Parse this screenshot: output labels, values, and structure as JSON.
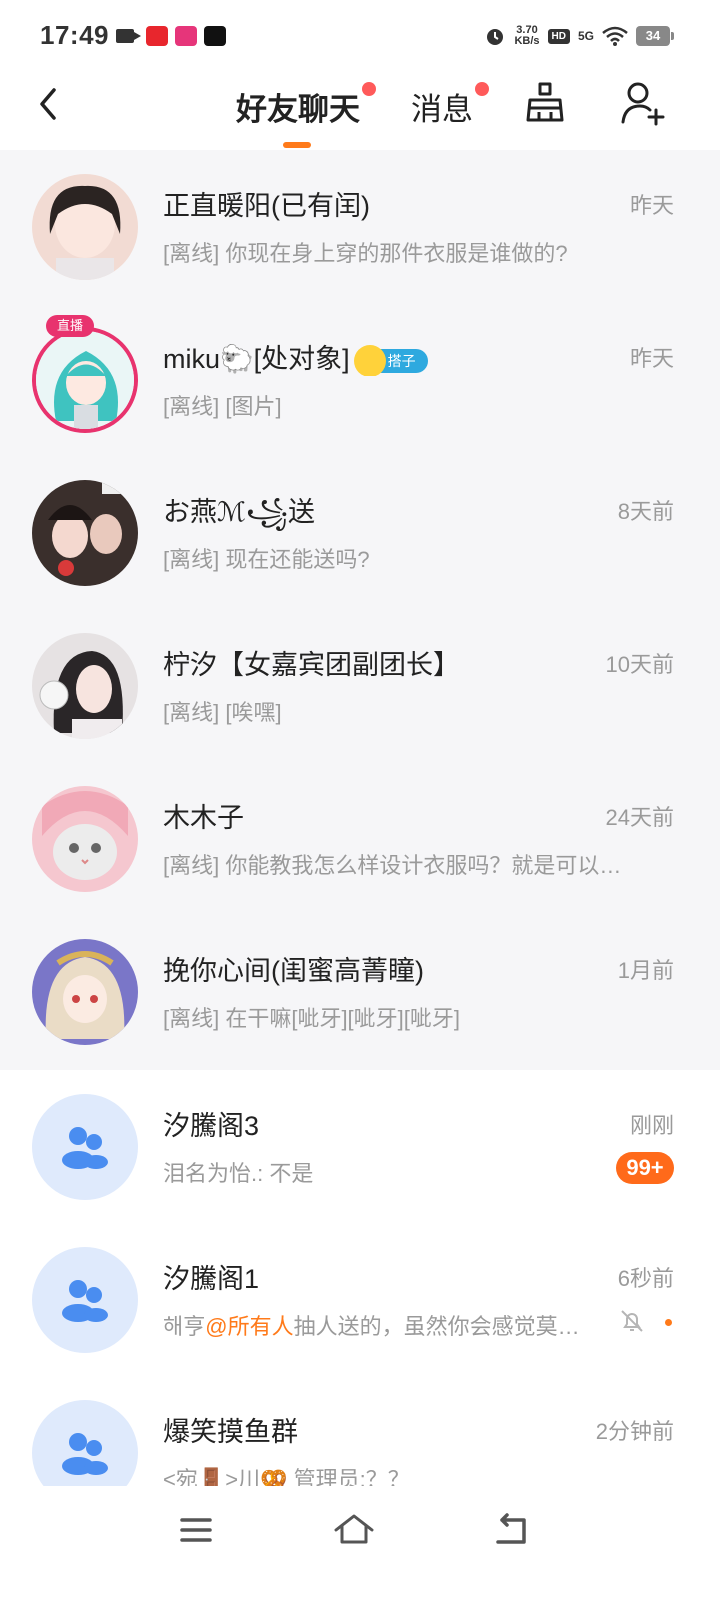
{
  "status_bar": {
    "time": "17:49",
    "net_speed_value": "3.70",
    "net_speed_unit": "KB/s",
    "hd_label": "HD",
    "signal_label": "5G",
    "battery": "34"
  },
  "header": {
    "tabs": [
      {
        "label": "好友聊天",
        "active": true,
        "has_dot": true
      },
      {
        "label": "消息",
        "active": false,
        "has_dot": true
      }
    ],
    "accent_color": "#ff7a1a",
    "dot_color": "#ff5a5a"
  },
  "conversations": [
    {
      "name": "正直暖阳(已有闰)",
      "time": "昨天",
      "preview": "[离线] 你现在身上穿的那件衣服是谁做的?",
      "type": "friend"
    },
    {
      "name": "miku🐑[处对象]",
      "time": "昨天",
      "preview": "[离线] [图片]",
      "type": "friend",
      "live_label": "直播",
      "tag": "搭子"
    },
    {
      "name": "お燕ℳ꧁送",
      "time": "8天前",
      "preview": "[离线] 现在还能送吗?",
      "type": "friend"
    },
    {
      "name": "柠汐【女嘉宾团副团长】",
      "time": "10天前",
      "preview": "[离线] [唉嘿]",
      "type": "friend"
    },
    {
      "name": "木木子",
      "time": "24天前",
      "preview": "[离线] 你能教我怎么样设计衣服吗？就是可以…",
      "type": "friend"
    },
    {
      "name": "挽你心间(闺蜜高菁瞳)",
      "time": "1月前",
      "preview": "[离线] 在干嘛[呲牙][呲牙][呲牙]",
      "type": "friend"
    },
    {
      "name": "汐騰阁3",
      "time": "刚刚",
      "preview": "泪名为怡.: 不是",
      "type": "group",
      "badge": "99+"
    },
    {
      "name": "汐騰阁1",
      "time": "6秒前",
      "preview_prefix": "해亨",
      "preview_mention": "@所有人",
      "preview_suffix": "抽人送的，虽然你会感觉莫…",
      "type": "group",
      "muted": true
    },
    {
      "name": "爆笑摸鱼群",
      "time": "2分钟前",
      "preview": "<宛🚪>川🥨 管理员:？？",
      "type": "group"
    }
  ]
}
